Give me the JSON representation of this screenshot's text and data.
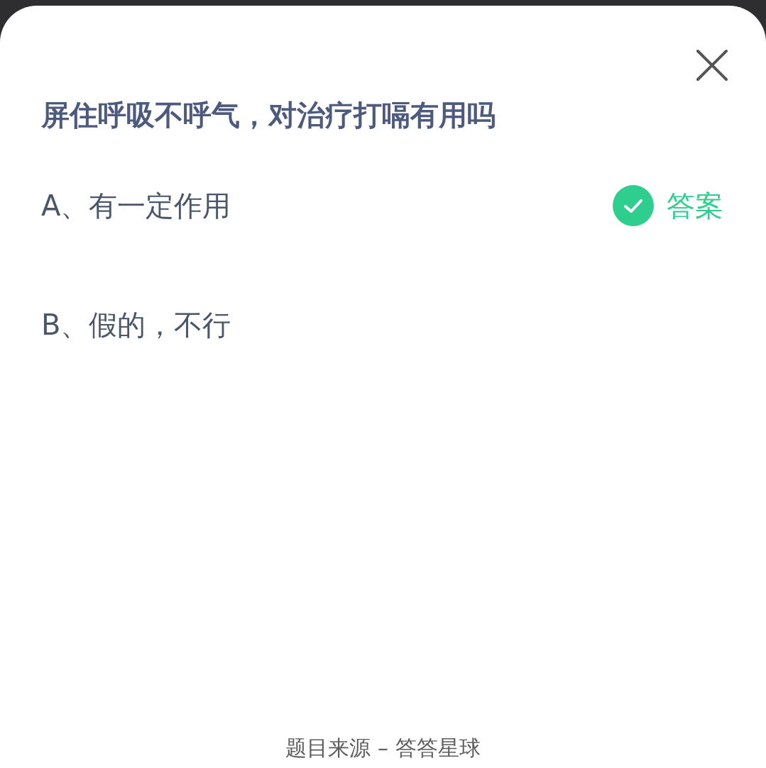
{
  "question": {
    "title": "屏住呼吸不呼气，对治疗打嗝有用吗"
  },
  "options": [
    {
      "label": "A、有一定作用",
      "correct": true
    },
    {
      "label": "B、假的，不行",
      "correct": false
    }
  ],
  "answer_label": "答案",
  "footer": "题目来源 – 答答星球"
}
